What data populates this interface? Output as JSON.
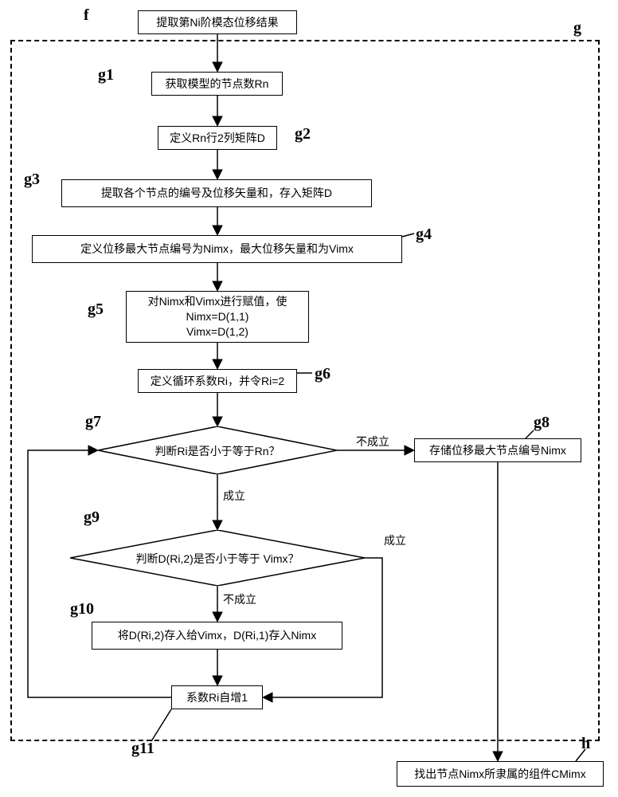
{
  "labels": {
    "f": "f",
    "g": "g",
    "g1": "g1",
    "g2": "g2",
    "g3": "g3",
    "g4": "g4",
    "g5": "g5",
    "g6": "g6",
    "g7": "g7",
    "g8": "g8",
    "g9": "g9",
    "g10": "g10",
    "g11": "g11",
    "h": "h"
  },
  "nodes": {
    "f": "提取第Ni阶模态位移结果",
    "g1": "获取模型的节点数Rn",
    "g2": "定义Rn行2列矩阵D",
    "g3": "提取各个节点的编号及位移矢量和，存入矩阵D",
    "g4": "定义位移最大节点编号为Nimx，最大位移矢量和为Vimx",
    "g5_line1": "对Nimx和Vimx进行赋值，使",
    "g5_line2": "Nimx=D(1,1)",
    "g5_line3": "Vimx=D(1,2)",
    "g6": "定义循环系数Ri，并令Ri=2",
    "g7": "判断Ri是否小于等于Rn？",
    "g8": "存储位移最大节点编号Nimx",
    "g9": "判断D(Ri,2)是否小于等于 Vimx？",
    "g10": "将D(Ri,2)存入给Vimx，D(Ri,1)存入Nimx",
    "g11": "系数Ri自增1",
    "h": "找出节点Nimx所隶属的组件CMimx"
  },
  "edges": {
    "no1": "不成立",
    "yes1": "成立",
    "no2": "不成立",
    "yes2": "成立"
  }
}
